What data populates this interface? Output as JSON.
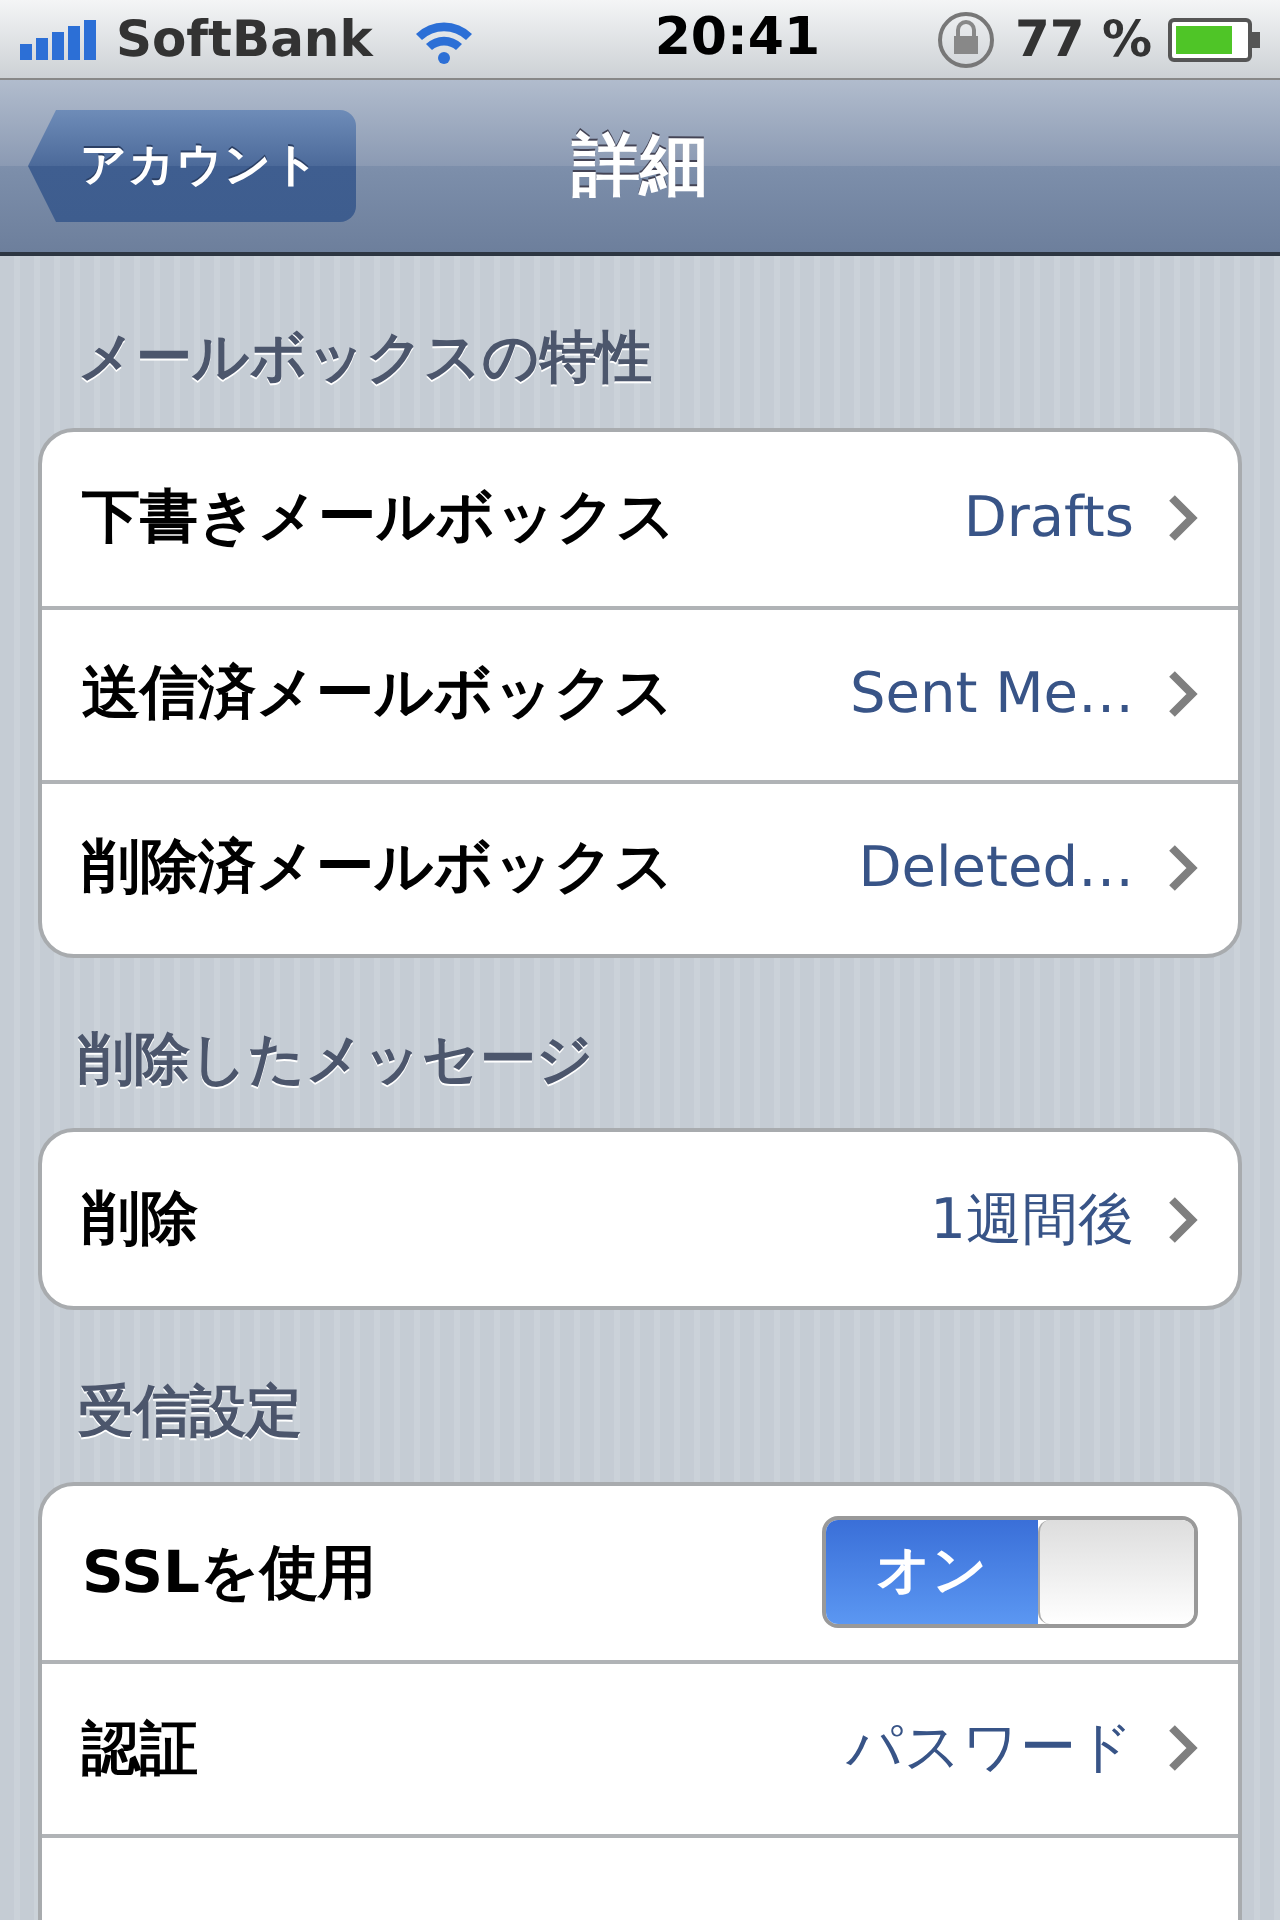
{
  "status_bar": {
    "carrier": "SoftBank",
    "time": "20:41",
    "battery": "77 %"
  },
  "nav": {
    "back": "アカウント",
    "title": "詳細"
  },
  "sections": [
    {
      "header": "メールボックスの特性",
      "rows": [
        {
          "kind": "disclosure",
          "label": "下書きメールボックス",
          "value": "Drafts"
        },
        {
          "kind": "disclosure",
          "label": "送信済メールボックス",
          "value": "Sent Me…"
        },
        {
          "kind": "disclosure",
          "label": "削除済メールボックス",
          "value": "Deleted…"
        }
      ]
    },
    {
      "header": "削除したメッセージ",
      "rows": [
        {
          "kind": "disclosure",
          "label": "削除",
          "value": "1週間後"
        }
      ]
    },
    {
      "header": "受信設定",
      "rows": [
        {
          "kind": "switch",
          "label": "SSLを使用",
          "on": true,
          "on_text": "オン"
        },
        {
          "kind": "disclosure",
          "label": "認証",
          "value": "パスワード"
        },
        {
          "kind": "partial"
        }
      ]
    }
  ]
}
